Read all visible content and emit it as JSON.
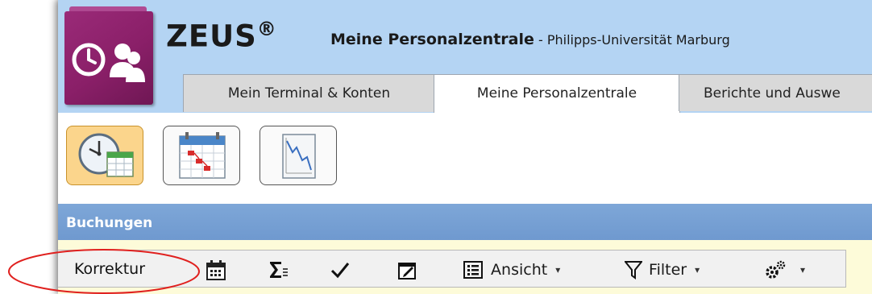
{
  "app": {
    "name": "ZEUS",
    "registered_mark": "®",
    "title_bold": "Meine Personalzentrale",
    "title_separator": " - ",
    "organization": "Philipps-Universität Marburg"
  },
  "tabs": [
    {
      "label": "Mein Terminal & Konten",
      "active": false
    },
    {
      "label": "Meine Personalzentrale",
      "active": true
    },
    {
      "label": "Berichte und Auswe",
      "active": false
    }
  ],
  "module_buttons": [
    {
      "icon": "clock-calendar-icon",
      "active": true
    },
    {
      "icon": "gantt-calendar-icon",
      "active": false
    },
    {
      "icon": "report-chart-icon",
      "active": false
    }
  ],
  "section": {
    "title": "Buchungen"
  },
  "action_bar": {
    "korrektur_label": "Korrektur",
    "view_label": "Ansicht",
    "filter_label": "Filter",
    "caret": "▾"
  },
  "colors": {
    "header_bg": "#b4d4f3",
    "logo": "#8a1f68",
    "section_bar": "#7ea7d8",
    "actions_bg": "#fdfbd9",
    "active_button": "#fbd58c",
    "highlight": "#e0201e"
  }
}
